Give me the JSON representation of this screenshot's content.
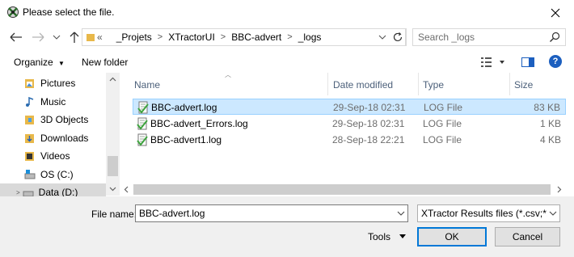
{
  "window": {
    "title": "Please select the file."
  },
  "address": {
    "overflow": "«",
    "crumbs": [
      "_Projets",
      "XTractorUI",
      "BBC-advert",
      "_logs"
    ]
  },
  "search": {
    "placeholder": "Search _logs"
  },
  "toolbar": {
    "organize_label": "Organize",
    "new_folder_label": "New folder",
    "help_label": "?"
  },
  "nav": {
    "items": [
      {
        "label": "Pictures",
        "icon": "pictures-icon"
      },
      {
        "label": "Music",
        "icon": "music-icon"
      },
      {
        "label": "3D Objects",
        "icon": "3d-objects-icon"
      },
      {
        "label": "Downloads",
        "icon": "downloads-icon"
      },
      {
        "label": "Videos",
        "icon": "videos-icon"
      },
      {
        "label": "OS (C:)",
        "icon": "drive-icon"
      },
      {
        "label": "Data (D:)",
        "icon": "drive-icon"
      }
    ]
  },
  "columns": {
    "name": "Name",
    "date": "Date modified",
    "type": "Type",
    "size": "Size"
  },
  "files": [
    {
      "name": "BBC-advert.log",
      "date": "29-Sep-18 02:31",
      "type": "LOG File",
      "size": "83 KB",
      "selected": true
    },
    {
      "name": "BBC-advert_Errors.log",
      "date": "29-Sep-18 02:31",
      "type": "LOG File",
      "size": "1 KB",
      "selected": false
    },
    {
      "name": "BBC-advert1.log",
      "date": "28-Sep-18 22:21",
      "type": "LOG File",
      "size": "4 KB",
      "selected": false
    }
  ],
  "bottom": {
    "filename_label": "File name:",
    "filename_value": "BBC-advert.log",
    "filter_value": "XTractor Results files (*.csv;*.log",
    "tools_label": "Tools",
    "ok_label": "OK",
    "cancel_label": "Cancel"
  },
  "colors": {
    "selection": "#cce8ff",
    "selection_border": "#99d1ff",
    "accent": "#0078d7",
    "folder": "#e8b84a"
  }
}
